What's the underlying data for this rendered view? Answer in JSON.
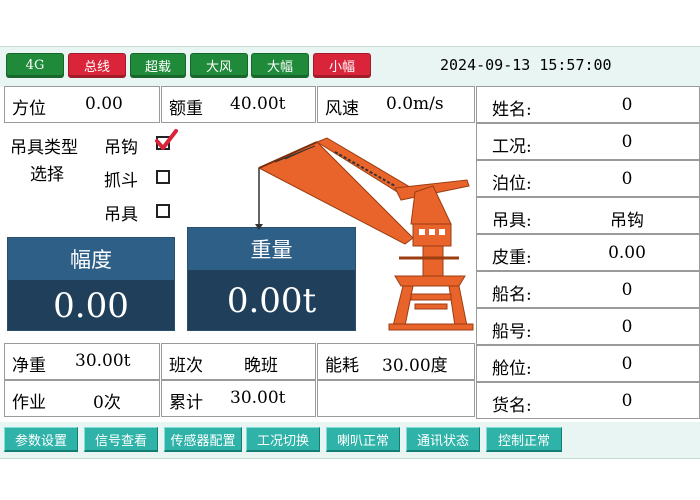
{
  "status_badges": [
    {
      "label": "4G",
      "color": "#1f8a3a"
    },
    {
      "label": "总线",
      "color": "#d9243a"
    },
    {
      "label": "超载",
      "color": "#1f8a3a"
    },
    {
      "label": "大风",
      "color": "#1f8a3a"
    },
    {
      "label": "大幅",
      "color": "#1f8a3a"
    },
    {
      "label": "小幅",
      "color": "#d9243a"
    }
  ],
  "datetime": "2024-09-13 15:57:00",
  "top_fields": {
    "azimuth_label": "方位",
    "azimuth_value": "0.00",
    "rated_load_label": "额重",
    "rated_load_value": "40.00t",
    "wind_speed_label": "风速",
    "wind_speed_value": "0.0m/s"
  },
  "spreader_select": {
    "title_line1": "吊具类型",
    "title_line2": "选择",
    "options": [
      {
        "label": "吊钩",
        "checked": true
      },
      {
        "label": "抓斗",
        "checked": false
      },
      {
        "label": "吊具",
        "checked": false
      }
    ]
  },
  "amplitude_panel": {
    "label": "幅度",
    "value": "0.00"
  },
  "weight_panel": {
    "label": "重量",
    "value": "0.00t"
  },
  "bottom_fields": {
    "net_weight_label": "净重",
    "net_weight_value": "30.00t",
    "shift_label": "班次",
    "shift_value": "晚班",
    "energy_label": "能耗",
    "energy_value": "30.00度",
    "jobs_label": "作业",
    "jobs_value": "0次",
    "total_label": "累计",
    "total_value": "30.00t"
  },
  "right_info": [
    {
      "label": "姓名:",
      "value": "0"
    },
    {
      "label": "工况:",
      "value": "0"
    },
    {
      "label": "泊位:",
      "value": "0"
    },
    {
      "label": "吊具:",
      "value": "吊钩"
    },
    {
      "label": "皮重:",
      "value": "0.00"
    },
    {
      "label": "船名:",
      "value": "0"
    },
    {
      "label": "船号:",
      "value": "0"
    },
    {
      "label": "舱位:",
      "value": "0"
    },
    {
      "label": "货名:",
      "value": "0"
    }
  ],
  "bottom_buttons": [
    {
      "label": "参数设置"
    },
    {
      "label": "信号查看"
    },
    {
      "label": "传感器配置"
    },
    {
      "label": "工况切换"
    },
    {
      "label": "喇叭正常"
    },
    {
      "label": "通讯状态"
    },
    {
      "label": "控制正常"
    }
  ],
  "crane_icon": "portal-crane-illustration",
  "check_icon": "red-check-mark"
}
